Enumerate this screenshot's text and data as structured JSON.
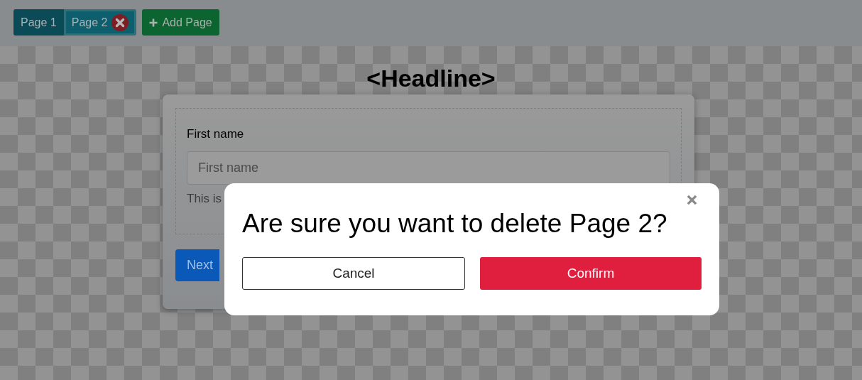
{
  "tabs": [
    {
      "label": "Page 1",
      "selected": false
    },
    {
      "label": "Page 2",
      "selected": true
    }
  ],
  "add_page_button": "Add Page",
  "headline": "<Headline>",
  "form": {
    "field_label": "First name",
    "placeholder": "First name",
    "help_text": "This is",
    "next_button": "Next"
  },
  "dialog": {
    "message": "Are sure you want to delete Page 2?",
    "cancel_button": "Cancel",
    "confirm_button": "Confirm"
  }
}
